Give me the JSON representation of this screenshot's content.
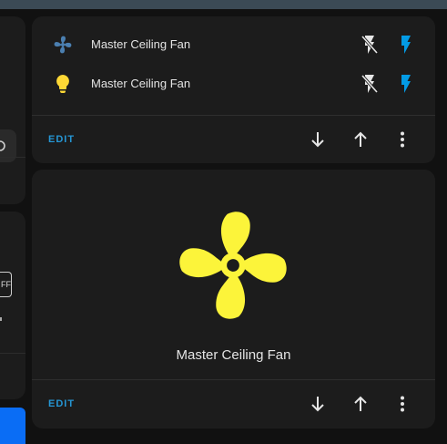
{
  "entities_card": {
    "rows": [
      {
        "name": "Master Ceiling Fan",
        "icon": "fan-icon",
        "icon_color": "#4b7fb0"
      },
      {
        "name": "Master Ceiling Fan",
        "icon": "lightbulb-icon",
        "icon_color": "#fdd835"
      }
    ],
    "off_icon": "flash-off-icon",
    "on_icon": "flash-icon",
    "on_color": "#039be5"
  },
  "fan_card": {
    "name": "Master Ceiling Fan",
    "icon": "fan-icon",
    "icon_color": "#fcf43a"
  },
  "footer": {
    "edit_label": "EDIT",
    "move_down_icon": "arrow-down-icon",
    "move_up_icon": "arrow-up-icon",
    "more_icon": "dots-vertical-icon"
  },
  "left_column": {
    "toggle_text": "FF"
  },
  "colors": {
    "accent": "#2596d4",
    "card_bg": "#1c1c1c",
    "page_bg": "#111111"
  }
}
